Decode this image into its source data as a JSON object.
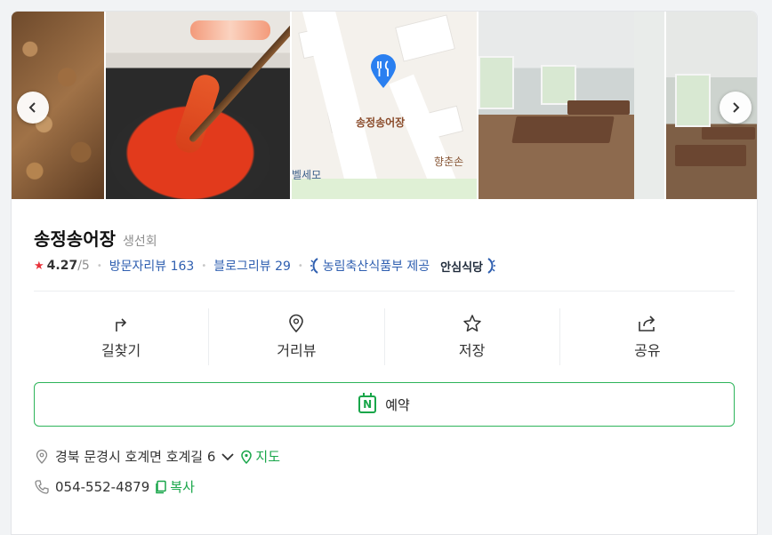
{
  "photos": [
    {
      "name": "food-photo-grilled"
    },
    {
      "name": "food-photo-sashimi"
    },
    {
      "name": "map-thumbnail",
      "pin_label": "송정송어장",
      "nearby_1": "향춘손",
      "nearby_2": "벨세모"
    },
    {
      "name": "interior-photo-1"
    },
    {
      "name": "interior-photo-2"
    }
  ],
  "place": {
    "name": "송정송어장",
    "category": "생선회",
    "rating": "4.27",
    "rating_max": "/5",
    "visitor_reviews": "방문자리뷰 163",
    "blog_reviews": "블로그리뷰 29",
    "certification": "농림축산식품부 제공",
    "certification_brand": "안심식당"
  },
  "actions": [
    {
      "label": "길찾기",
      "icon": "directions-icon"
    },
    {
      "label": "거리뷰",
      "icon": "location-pin-icon"
    },
    {
      "label": "저장",
      "icon": "star-icon"
    },
    {
      "label": "공유",
      "icon": "share-icon"
    }
  ],
  "reserve": {
    "label": "예약",
    "icon": "naver-booking-icon"
  },
  "address": {
    "text": "경북 문경시 호계면 호계길 6",
    "map_link": "지도"
  },
  "phone": {
    "number": "054-552-4879",
    "copy_label": "복사"
  },
  "colors": {
    "accent_green": "#19a64a",
    "link_blue": "#2f5fb0",
    "star_red": "#e8323a"
  }
}
